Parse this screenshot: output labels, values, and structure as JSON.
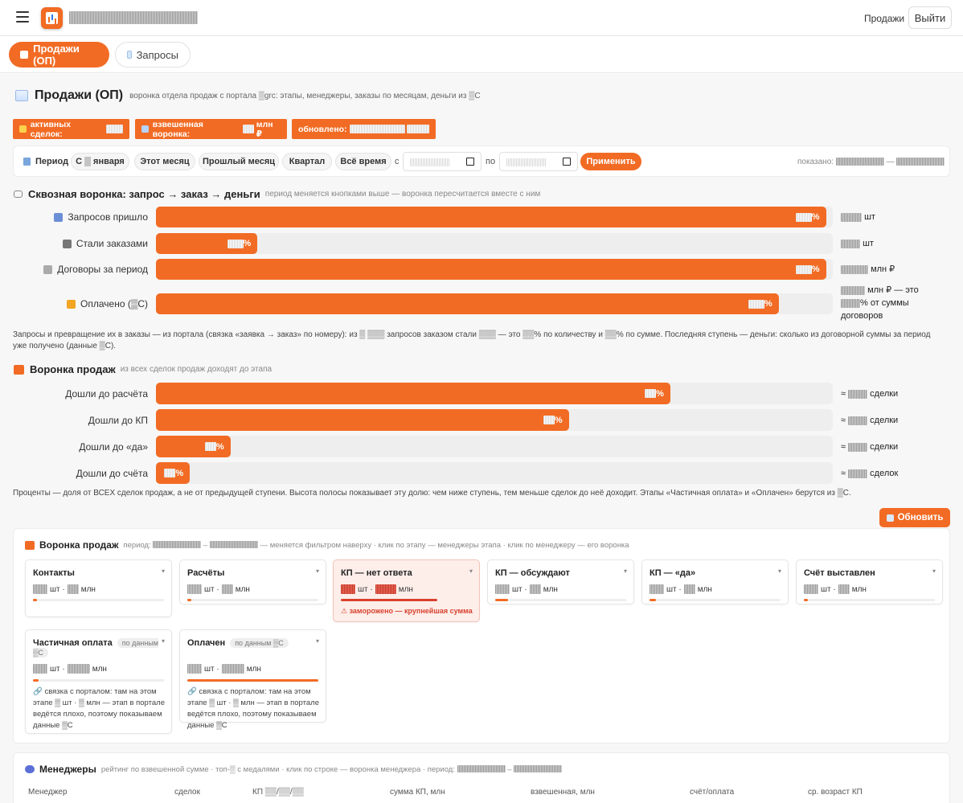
{
  "topbar": {
    "nav_link": "Продажи",
    "logout": "Выйти"
  },
  "tabs": [
    {
      "label": "Продажи (ОП)",
      "active": true,
      "icon": "chart-icon"
    },
    {
      "label": "Запросы",
      "active": false,
      "icon": "doc-icon"
    }
  ],
  "header": {
    "title": "Продажи (ОП)",
    "subtitle": "воронка отдела продаж с портала ▒grc: этапы, менеджеры, заказы по месяцам, деньги из ▒С"
  },
  "badges": {
    "active_deals": "активных сделок:",
    "weighted": "взвешенная воронка:",
    "weighted_unit": "млн ₽",
    "updated": "обновлено:"
  },
  "period": {
    "label": "Период",
    "buttons": [
      "С ▒ января",
      "Этот месяц",
      "Прошлый месяц",
      "Квартал",
      "Всё время"
    ],
    "from_label": "с",
    "to_label": "по",
    "apply": "Применить",
    "shown_label": "показано:"
  },
  "through_funnel": {
    "title": "Сквозная воронка: запрос → заказ → деньги",
    "subtitle": "период меняется кнопками выше — воронка пересчитается вместе с ним",
    "rows": [
      {
        "label": "Запросов пришло",
        "fill": 0.99,
        "icon": "inbox-icon",
        "unit": "шт"
      },
      {
        "label": "Стали заказами",
        "fill": 0.15,
        "icon": "tools-icon",
        "unit": "шт"
      },
      {
        "label": "Договоры за период",
        "fill": 0.99,
        "icon": "contract-icon",
        "unit": "млн ₽"
      },
      {
        "label": "Оплачено (▒С)",
        "fill": 0.92,
        "icon": "money-bag-icon",
        "unit": "млн ₽ — это",
        "unit2": "% от суммы договоров"
      }
    ],
    "note": "Запросы и превращение их в заказы — из портала (связка «заявка → заказ» по номеру): из ▒ ▒▒▒ запросов заказом стали ▒▒▒ — это ▒▒% по количеству и ▒▒% по сумме. Последняя ступень — деньги: сколько из договорной суммы за период уже получено (данные ▒С)."
  },
  "sales_funnel": {
    "title": "Воронка продаж",
    "subtitle": "из всех сделок продаж доходят до этапа",
    "rows": [
      {
        "label": "Дошли до расчёта",
        "fill": 0.76,
        "unit": "сделки"
      },
      {
        "label": "Дошли до КП",
        "fill": 0.61,
        "unit": "сделки"
      },
      {
        "label": "Дошли до «да»",
        "fill": 0.11,
        "unit": "сделки"
      },
      {
        "label": "Дошли до счёта",
        "fill": 0.05,
        "unit": "сделок"
      }
    ],
    "approx": "≈",
    "note": "Проценты — доля от ВСЕХ сделок продаж, а не от предыдущей ступени. Высота полосы показывает эту долю: чем ниже ступень, тем меньше сделок до неё доходит. Этапы «Частичная оплата» и «Оплачен» берутся из ▒С."
  },
  "refresh": "Обновить",
  "stage_card": {
    "title": "Воронка продаж",
    "subtitle_pre": "период:",
    "subtitle_post": "— меняется фильтром наверху · клик по этапу — менеджеры этапа · клик по менеджеру — его воронка",
    "shtl": "шт ·",
    "mln": "млн",
    "stages": [
      {
        "name": "Контакты",
        "progress": 0.02
      },
      {
        "name": "Расчёты",
        "progress": 0.02
      },
      {
        "name": "КП — нет ответа",
        "progress": 0.65,
        "frozen": true,
        "warning": "⚠ заморожено — крупнейшая сумма"
      },
      {
        "name": "КП — обсуждают",
        "progress": 0.1
      },
      {
        "name": "КП — «да»",
        "progress": 0.05
      },
      {
        "name": "Счёт выставлен",
        "progress": 0.03
      },
      {
        "name": "Частичная оплата",
        "sub": "по данным ▒С",
        "progress": 0.04,
        "link_note": "🔗 связка с порталом: там на этом этапе ▒ шт · ▒ млн — этап в портале ведётся плохо, поэтому показываем данные ▒С"
      },
      {
        "name": "Оплачен",
        "sub": "по данным ▒С",
        "progress": 1.0,
        "link_note": "🔗 связка с порталом: там на этом этапе ▒ шт · ▒ млн — этап в портале ведётся плохо, поэтому показываем данные ▒С"
      }
    ]
  },
  "managers": {
    "title": "Менеджеры",
    "subtitle": "рейтинг по взвешенной сумме · топ-▒ с медалями · клик по строке — воронка менеджера · период:",
    "columns": [
      "Менеджер",
      "сделок",
      "КП ▒▒/▒▒/▒▒",
      "сумма КП, млн",
      "взвешенная, млн",
      "счёт/оплата",
      "ср. возраст КП"
    ]
  },
  "colors": {
    "accent": "#f26b24",
    "track": "#eeeeee",
    "frozen_bg": "#fdeeea",
    "warning": "#d8412d"
  }
}
